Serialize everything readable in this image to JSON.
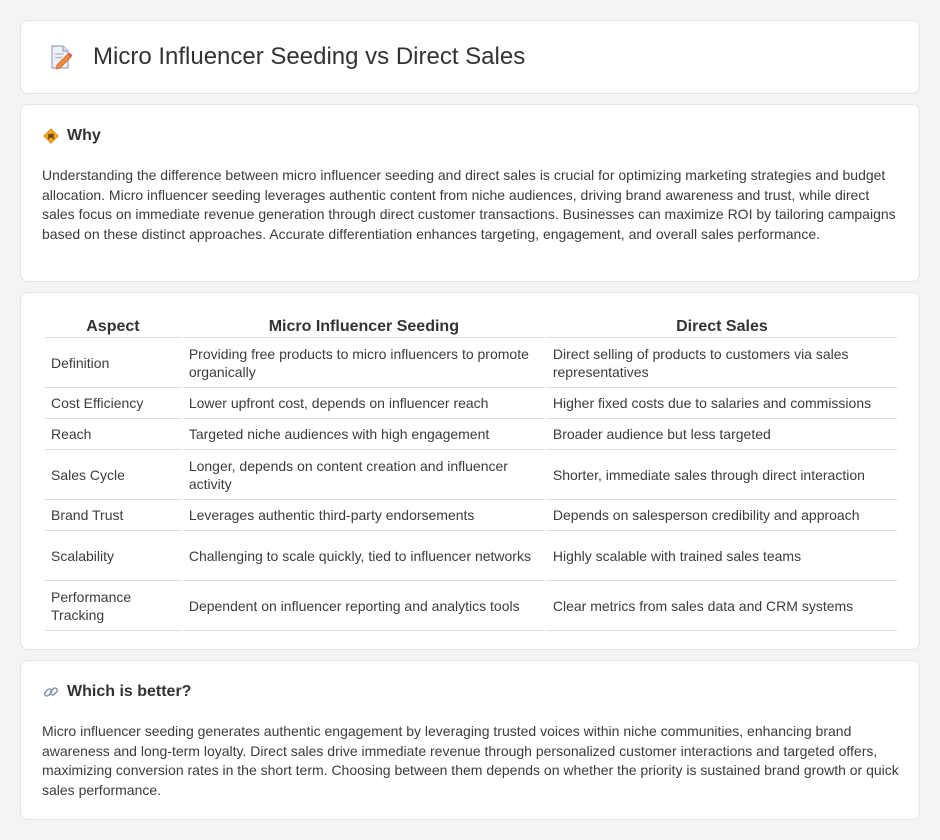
{
  "page": {
    "title": "Micro Influencer Seeding vs Direct Sales",
    "title_icon": "document-edit-icon"
  },
  "why": {
    "heading": "Why",
    "icon": "diamond-sign-icon",
    "text": "Understanding the difference between micro influencer seeding and direct sales is crucial for optimizing marketing strategies and budget allocation. Micro influencer seeding leverages authentic content from niche audiences, driving brand awareness and trust, while direct sales focus on immediate revenue generation through direct customer transactions. Businesses can maximize ROI by tailoring campaigns based on these distinct approaches. Accurate differentiation enhances targeting, engagement, and overall sales performance."
  },
  "comparison": {
    "headers": [
      "Aspect",
      "Micro Influencer Seeding",
      "Direct Sales"
    ],
    "rows": [
      [
        "Definition",
        "Providing free products to micro influencers to promote organically",
        "Direct selling of products to customers via sales representatives"
      ],
      [
        "Cost Efficiency",
        "Lower upfront cost, depends on influencer reach",
        "Higher fixed costs due to salaries and commissions"
      ],
      [
        "Reach",
        "Targeted niche audiences with high engagement",
        "Broader audience but less targeted"
      ],
      [
        "Sales Cycle",
        "Longer, depends on content creation and influencer activity",
        "Shorter, immediate sales through direct interaction"
      ],
      [
        "Brand Trust",
        "Leverages authentic third-party endorsements",
        "Depends on salesperson credibility and approach"
      ],
      [
        "Scalability",
        "Challenging to scale quickly, tied to influencer networks",
        "Highly scalable with trained sales teams"
      ],
      [
        "Performance Tracking",
        "Dependent on influencer reporting and analytics tools",
        "Clear metrics from sales data and CRM systems"
      ]
    ]
  },
  "better": {
    "heading": "Which is better?",
    "icon": "link-icon",
    "text": "Micro influencer seeding generates authentic engagement by leveraging trusted voices within niche communities, enhancing brand awareness and long-term loyalty. Direct sales drive immediate revenue through personalized customer interactions and targeted offers, maximizing conversion rates in the short term. Choosing between them depends on whether the priority is sustained brand growth or quick sales performance."
  }
}
